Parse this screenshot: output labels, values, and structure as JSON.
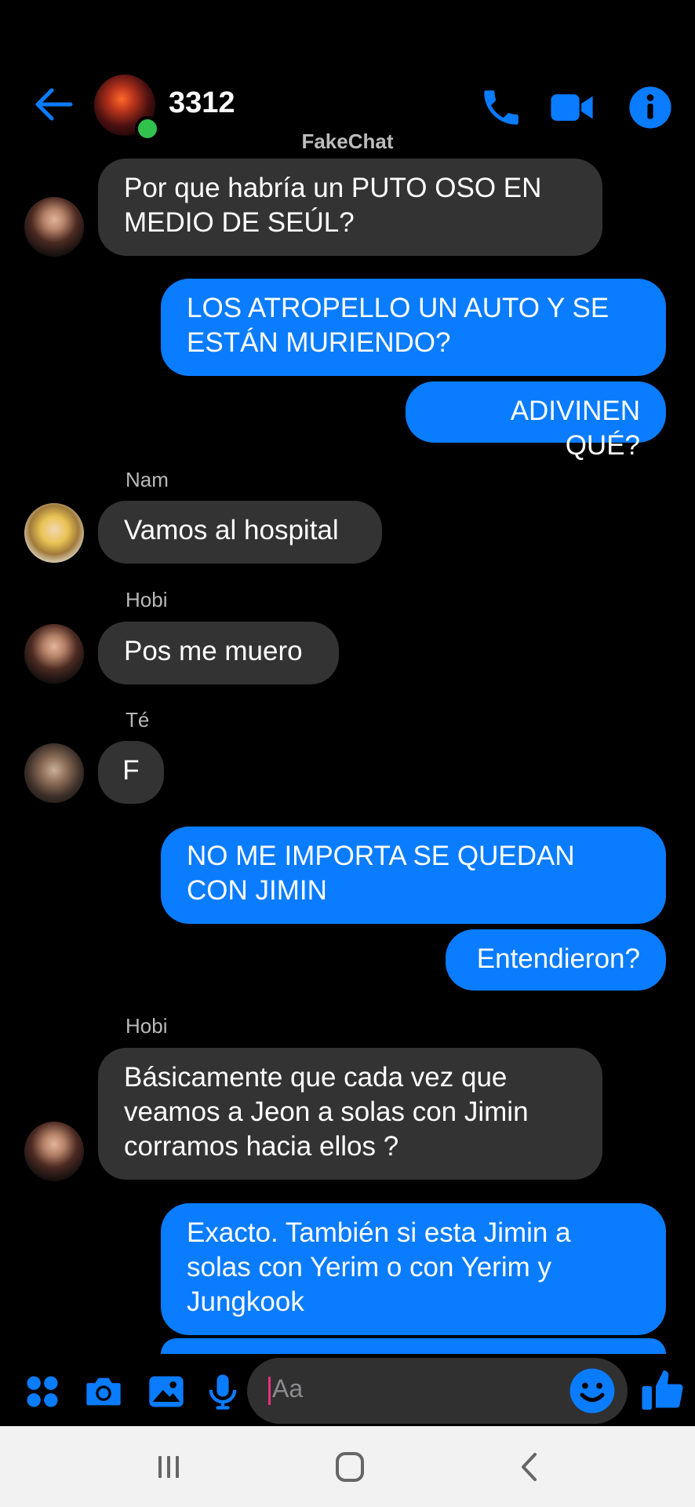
{
  "header": {
    "title": "3312",
    "watermark": "FakeChat",
    "icons": [
      "back-arrow-icon",
      "group-avatar",
      "phone-icon",
      "video-camera-icon",
      "info-icon"
    ],
    "accent_color": "#0a7cff",
    "online_color": "#31c24d"
  },
  "messages": [
    {
      "direction": "in",
      "sender": "",
      "text": "Por que habría un PUTO OSO EN MEDIO DE SEÚL?"
    },
    {
      "direction": "out",
      "text": "LOS ATROPELLO UN AUTO Y SE ESTÁN MURIENDO?"
    },
    {
      "direction": "out",
      "text": "ADIVINEN QUÉ?"
    },
    {
      "direction": "in",
      "sender": "Nam",
      "text": "Vamos al hospital"
    },
    {
      "direction": "in",
      "sender": "Hobi",
      "text": "Pos me muero"
    },
    {
      "direction": "in",
      "sender": "Té",
      "text": "F"
    },
    {
      "direction": "out",
      "text": "NO ME IMPORTA SE QUEDAN CON JIMIN"
    },
    {
      "direction": "out",
      "text": "Entendieron?"
    },
    {
      "direction": "in",
      "sender": "Hobi",
      "text": "Básicamente que cada vez que veamos a Jeon a solas con Jimin corramos hacia ellos ?"
    },
    {
      "direction": "out",
      "text": "Exacto. También si esta Jimin a solas con Yerim o con Yerim y Jungkook"
    }
  ],
  "composer": {
    "placeholder": "Aa",
    "icons": [
      "apps-icon",
      "camera-icon",
      "image-icon",
      "microphone-icon",
      "emoji-icon",
      "thumbs-up-icon"
    ]
  },
  "navbar": {
    "icons": [
      "recent-apps-icon",
      "home-icon",
      "back-icon"
    ]
  },
  "colors": {
    "background": "#000000",
    "incoming_bubble": "#333334",
    "outgoing_bubble": "#0a7cff"
  }
}
